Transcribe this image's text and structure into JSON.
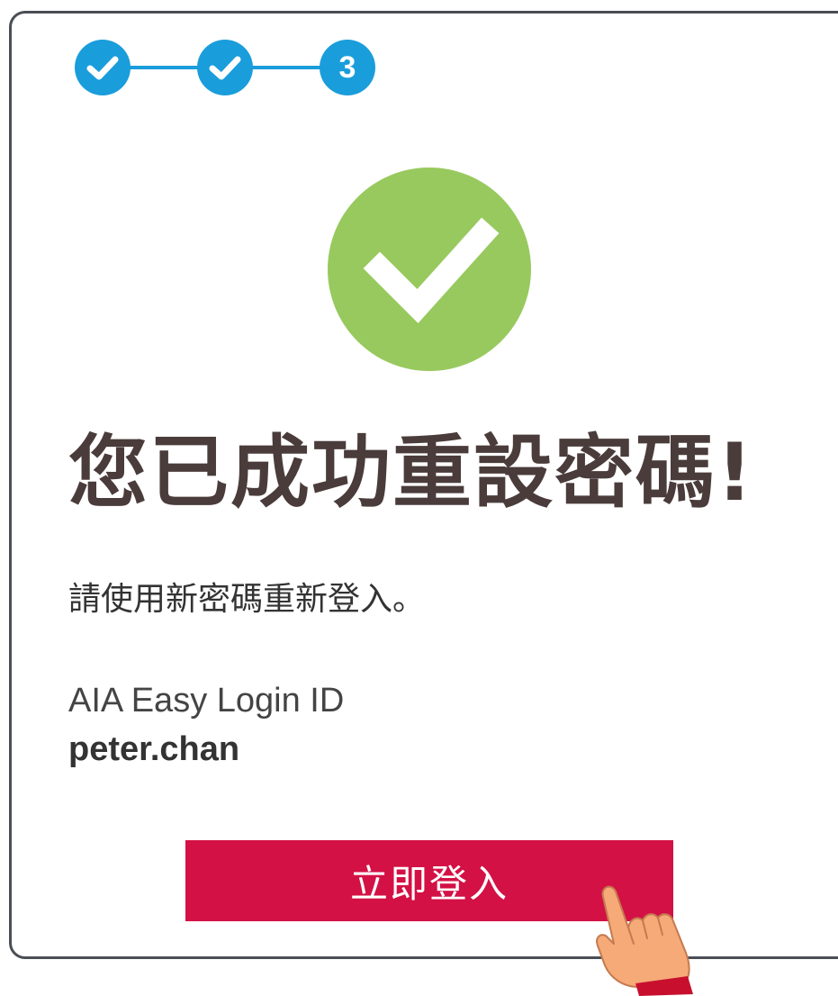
{
  "stepper": {
    "steps": [
      {
        "state": "completed",
        "icon": "check-icon"
      },
      {
        "state": "completed",
        "icon": "check-icon"
      },
      {
        "state": "current",
        "number": "3"
      }
    ],
    "color": "#1a9ddb"
  },
  "success": {
    "icon": "check-circle-icon",
    "color": "#98c95e"
  },
  "title": "您已成功重設密碼!",
  "instruction": "請使用新密碼重新登入。",
  "login_id": {
    "label": "AIA Easy Login ID",
    "value": "peter.chan"
  },
  "login_button": {
    "label": "立即登入",
    "color": "#d31145"
  },
  "pointer": {
    "icon": "pointing-hand-icon"
  }
}
